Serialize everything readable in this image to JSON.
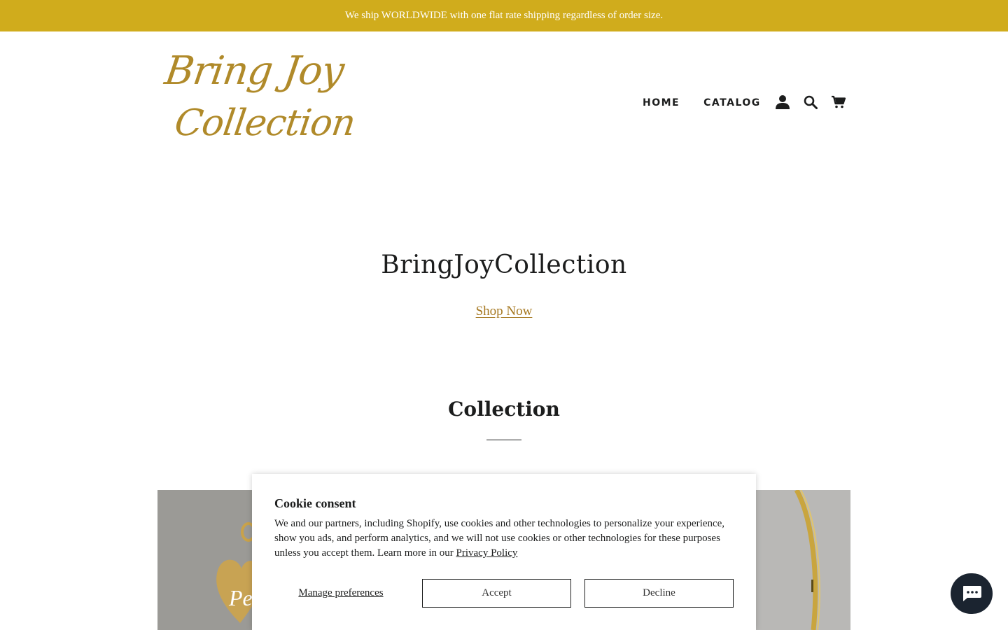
{
  "announcement": {
    "text": "We ship WORLDWIDE with one flat rate shipping regardless of order size.",
    "background": "#d0ac1c"
  },
  "logo": {
    "line1": "Bring Joy",
    "line2": "Collection",
    "color": "#b08a2a"
  },
  "nav": {
    "items": [
      {
        "label": "HOME"
      },
      {
        "label": "CATALOG"
      }
    ],
    "icons": [
      "account-icon",
      "search-icon",
      "cart-icon"
    ]
  },
  "hero": {
    "title": "BringJoyCollection",
    "cta_label": "Shop Now",
    "cta_color": "#a5771f"
  },
  "collection": {
    "title": "Collection",
    "cards": [
      {
        "label": "Pe"
      }
    ]
  },
  "cookie_consent": {
    "title": "Cookie consent",
    "body": "We and our partners, including Shopify, use cookies and other technologies to personalize your experience, show you ads, and perform analytics, and we will not use cookies or other technologies for these purposes unless you accept them. Learn more in our ",
    "privacy_link": "Privacy Policy",
    "manage_label": "Manage preferences",
    "accept_label": "Accept",
    "decline_label": "Decline"
  },
  "chat": {
    "icon": "chat-icon",
    "background": "#1b2430"
  }
}
